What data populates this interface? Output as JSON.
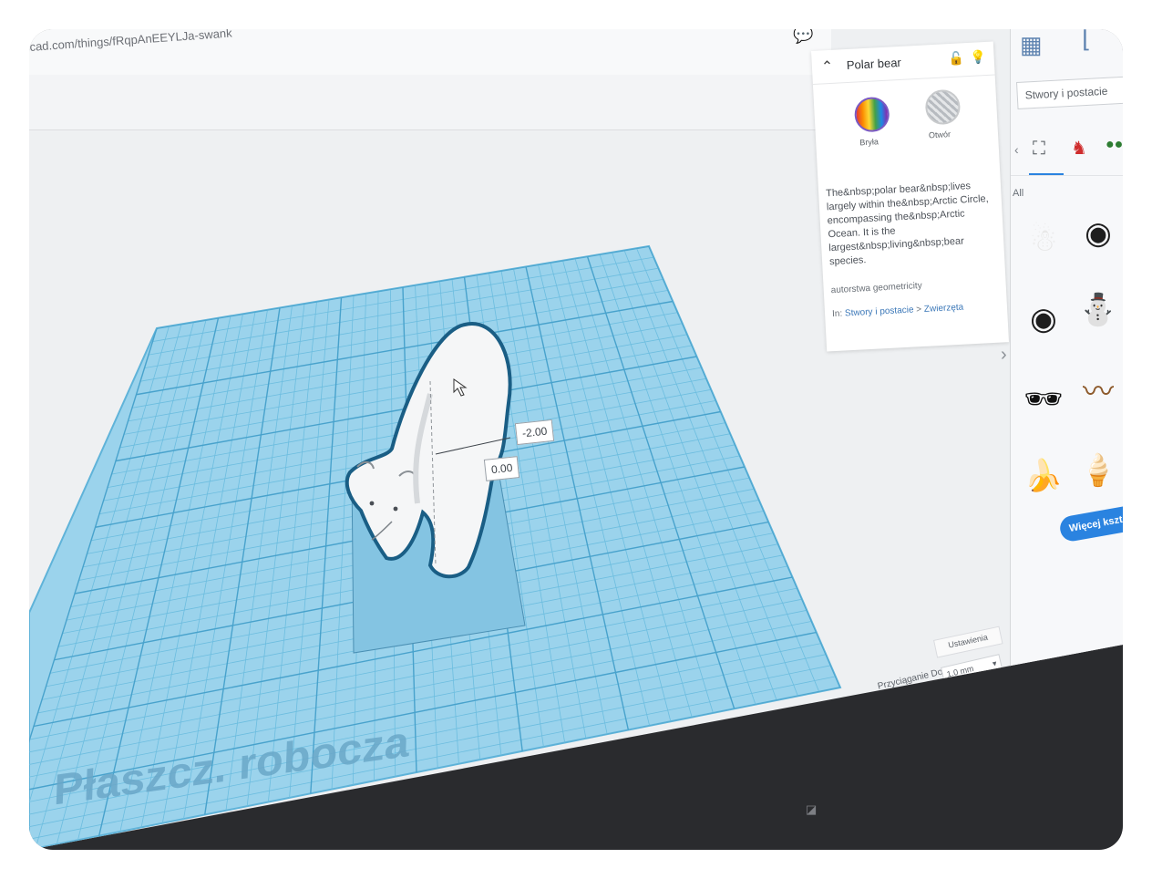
{
  "browser": {
    "url": "cad.com/things/fRqpAnEEYLJa-swank"
  },
  "inspector": {
    "title": "Polar bear",
    "solid_label": "Bryła",
    "hole_label": "Otwór",
    "description": "The&nbsp;polar bear&nbsp;lives largely within the&nbsp;Arctic Circle, encompassing the&nbsp;Arctic Ocean. It is the largest&nbsp;living&nbsp;bear species.",
    "author": "autorstwa geometricity",
    "breadcrumb_prefix": "In:",
    "breadcrumb_category": "Stwory i postacie",
    "breadcrumb_separator": ">",
    "breadcrumb_sub": "Zwierzęta"
  },
  "workplane": {
    "label": "Płaszcz. robocza",
    "dim_height": "-2.00",
    "dim_elevation": "0.00",
    "snap_label": "Przyciąganie Do Siatki",
    "snap_value": "1.0 mm",
    "settings_label": "Ustawienia"
  },
  "shapes_panel": {
    "library": "Stwory i postacie",
    "filter_all": "All",
    "more_button": "Więcej kształt"
  },
  "colors": {
    "grid": "#7ec8e8",
    "accent_blue": "#2a83e0",
    "selection_outline": "#1a5e85"
  }
}
